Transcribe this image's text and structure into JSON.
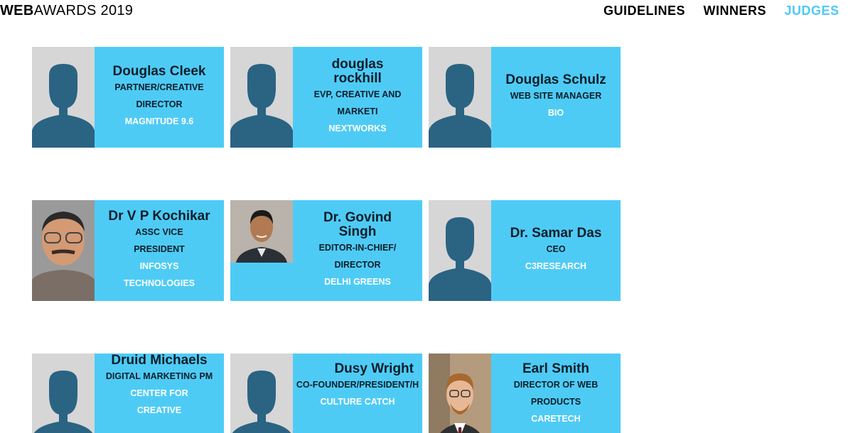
{
  "header": {
    "logo_bold": "WEB",
    "logo_light": "AWARDS 2019",
    "nav": [
      "GUIDELINES",
      "WINNERS",
      "JUDGES"
    ]
  },
  "colors": {
    "accent": "#4ecbf5",
    "avatar_bg": "#d6d6d6",
    "avatar_fg": "#2b6383",
    "nav_active": "#4ec9f5"
  },
  "judges": [
    {
      "name": "Douglas Cleek",
      "title": "PARTNER/CREATIVE DIRECTOR",
      "company": "MAGNITUDE 9.6",
      "photo": "placeholder-avatar-icon"
    },
    {
      "name": "douglas rockhill",
      "title": "EVP, CREATIVE AND MARKETI",
      "company": "NEXTWORKS",
      "photo": "placeholder-avatar-icon"
    },
    {
      "name": "Douglas Schulz",
      "title": "WEB SITE MANAGER",
      "company": "BIO",
      "photo": "placeholder-avatar-icon"
    },
    {
      "name": "Dr V P Kochikar",
      "title": "ASSC VICE PRESIDENT",
      "company": "INFOSYS TECHNOLOGIES",
      "photo": "portrait-photo"
    },
    {
      "name": "Dr. Govind Singh",
      "title": "EDITOR-IN-CHIEF/ DIRECTOR",
      "company": "DELHI GREENS",
      "photo": "portrait-photo"
    },
    {
      "name": "Dr. Samar Das",
      "title": "CEO",
      "company": "C3RESEARCH",
      "photo": "placeholder-avatar-icon"
    },
    {
      "name": "Druid Michaels",
      "title": "DIGITAL MARKETING PM",
      "company": "CENTER FOR CREATIVE",
      "photo": "placeholder-avatar-icon"
    },
    {
      "name": "Dusy Wright",
      "title": "CO-FOUNDER/PRESIDENT/H",
      "company": "CULTURE CATCH",
      "photo": "placeholder-avatar-icon"
    },
    {
      "name": "Earl Smith",
      "title": "DIRECTOR OF WEB PRODUCTS",
      "company": "CARETECH",
      "photo": "portrait-photo"
    }
  ]
}
